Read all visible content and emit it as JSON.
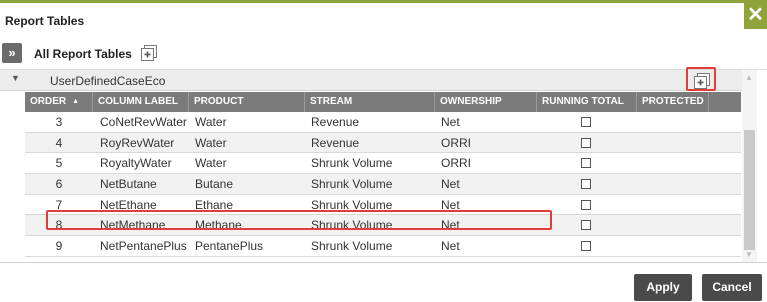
{
  "dialog": {
    "title": "Report Tables",
    "close_icon": "close-icon"
  },
  "toolbar": {
    "expand_icon": "double-chevron-right-icon",
    "expand_glyph": "»",
    "title": "All Report Tables",
    "add_icon": "add-table-icon"
  },
  "group": {
    "caret": "▼",
    "label": "UserDefinedCaseEco",
    "add_icon": "add-row-icon"
  },
  "columns": {
    "order": "ORDER",
    "column_label": "COLUMN LABEL",
    "product": "PRODUCT",
    "stream": "STREAM",
    "ownership": "OWNERSHIP",
    "running_total": "RUNNING TOTAL",
    "protected": "PROTECTED",
    "sort_glyph": "▲"
  },
  "rows": [
    {
      "order": "3",
      "column_label": "CoNetRevWater",
      "product": "Water",
      "stream": "Revenue",
      "ownership": "Net",
      "running_total": false
    },
    {
      "order": "4",
      "column_label": "RoyRevWater",
      "product": "Water",
      "stream": "Revenue",
      "ownership": "ORRI",
      "running_total": false
    },
    {
      "order": "5",
      "column_label": "RoyaltyWater",
      "product": "Water",
      "stream": "Shrunk Volume",
      "ownership": "ORRI",
      "running_total": false
    },
    {
      "order": "6",
      "column_label": "NetButane",
      "product": "Butane",
      "stream": "Shrunk Volume",
      "ownership": "Net",
      "running_total": false
    },
    {
      "order": "7",
      "column_label": "NetEthane",
      "product": "Ethane",
      "stream": "Shrunk Volume",
      "ownership": "Net",
      "running_total": false
    },
    {
      "order": "8",
      "column_label": "NetMethane",
      "product": "Methane",
      "stream": "Shrunk Volume",
      "ownership": "Net",
      "running_total": false
    },
    {
      "order": "9",
      "column_label": "NetPentanePlus",
      "product": "PentanePlus",
      "stream": "Shrunk Volume",
      "ownership": "Net",
      "running_total": false
    }
  ],
  "scrollbar": {
    "up_glyph": "▲",
    "down_glyph": "▼"
  },
  "footer": {
    "apply_label": "Apply",
    "cancel_label": "Cancel"
  },
  "colors": {
    "accent": "#8ea33c",
    "header": "#7b7b7b",
    "button": "#4a4a4a",
    "highlight": "#e03d3d"
  }
}
